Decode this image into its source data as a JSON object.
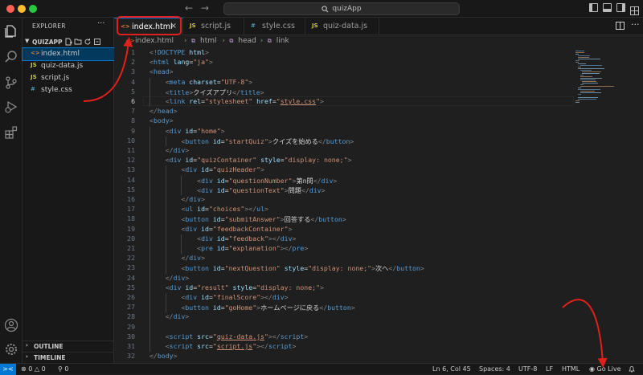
{
  "window": {
    "search_text": "quizApp"
  },
  "sidebar": {
    "title": "EXPLORER",
    "more": "···",
    "folder": "QUIZAPP",
    "files": [
      {
        "label": "index.html",
        "icon": "<>",
        "kind": "html",
        "active": true
      },
      {
        "label": "quiz-data.js",
        "icon": "JS",
        "kind": "js",
        "active": false
      },
      {
        "label": "script.js",
        "icon": "JS",
        "kind": "js",
        "active": false
      },
      {
        "label": "style.css",
        "icon": "#",
        "kind": "css",
        "active": false
      }
    ],
    "outline": "OUTLINE",
    "timeline": "TIMELINE"
  },
  "tabs": [
    {
      "label": "index.html",
      "icon": "<>",
      "kind": "html",
      "active": true,
      "close": "×"
    },
    {
      "label": "script.js",
      "icon": "JS",
      "kind": "js",
      "active": false
    },
    {
      "label": "style.css",
      "icon": "#",
      "kind": "css",
      "active": false
    },
    {
      "label": "quiz-data.js",
      "icon": "JS",
      "kind": "js",
      "active": false
    }
  ],
  "tab_more": "···",
  "breadcrumb": [
    "index.html",
    "html",
    "head",
    "link"
  ],
  "current_line": 6,
  "code": [
    [
      [
        "t-brk",
        "<!"
      ],
      [
        "t-tag",
        "DOCTYPE"
      ],
      [
        "t-attr",
        " html"
      ],
      [
        "t-brk",
        ">"
      ]
    ],
    [
      [
        "t-brk",
        "<"
      ],
      [
        "t-tag",
        "html"
      ],
      [
        "t-attr",
        " lang"
      ],
      [
        "t-txt",
        "="
      ],
      [
        "t-str",
        "\"ja\""
      ],
      [
        "t-brk",
        ">"
      ]
    ],
    [
      [
        "t-brk",
        "<"
      ],
      [
        "t-tag",
        "head"
      ],
      [
        "t-brk",
        ">"
      ]
    ],
    [
      [
        "t-txt",
        "    "
      ],
      [
        "t-brk",
        "<"
      ],
      [
        "t-tag",
        "meta"
      ],
      [
        "t-attr",
        " charset"
      ],
      [
        "t-txt",
        "="
      ],
      [
        "t-str",
        "\"UTF-8\""
      ],
      [
        "t-brk",
        ">"
      ]
    ],
    [
      [
        "t-txt",
        "    "
      ],
      [
        "t-brk",
        "<"
      ],
      [
        "t-tag",
        "title"
      ],
      [
        "t-brk",
        ">"
      ],
      [
        "t-txt",
        "クイズアプリ"
      ],
      [
        "t-brk",
        "</"
      ],
      [
        "t-tag",
        "title"
      ],
      [
        "t-brk",
        ">"
      ]
    ],
    [
      [
        "t-txt",
        "    "
      ],
      [
        "t-brk",
        "<"
      ],
      [
        "t-tag",
        "link"
      ],
      [
        "t-attr",
        " rel"
      ],
      [
        "t-txt",
        "="
      ],
      [
        "t-str",
        "\"stylesheet\""
      ],
      [
        "t-attr",
        " href"
      ],
      [
        "t-txt",
        "="
      ],
      [
        "t-str",
        "\""
      ],
      [
        "t-str t-ul",
        "style.css"
      ],
      [
        "t-str",
        "\""
      ],
      [
        "t-brk",
        ">"
      ]
    ],
    [
      [
        "t-brk",
        "</"
      ],
      [
        "t-tag",
        "head"
      ],
      [
        "t-brk",
        ">"
      ]
    ],
    [
      [
        "t-brk",
        "<"
      ],
      [
        "t-tag",
        "body"
      ],
      [
        "t-brk",
        ">"
      ]
    ],
    [
      [
        "t-txt",
        "    "
      ],
      [
        "t-brk",
        "<"
      ],
      [
        "t-tag",
        "div"
      ],
      [
        "t-attr",
        " id"
      ],
      [
        "t-txt",
        "="
      ],
      [
        "t-str",
        "\"home\""
      ],
      [
        "t-brk",
        ">"
      ]
    ],
    [
      [
        "t-txt",
        "        "
      ],
      [
        "t-brk",
        "<"
      ],
      [
        "t-tag",
        "button"
      ],
      [
        "t-attr",
        " id"
      ],
      [
        "t-txt",
        "="
      ],
      [
        "t-str",
        "\"startQuiz\""
      ],
      [
        "t-brk",
        ">"
      ],
      [
        "t-txt",
        "クイズを始める"
      ],
      [
        "t-brk",
        "</"
      ],
      [
        "t-tag",
        "button"
      ],
      [
        "t-brk",
        ">"
      ]
    ],
    [
      [
        "t-txt",
        "    "
      ],
      [
        "t-brk",
        "</"
      ],
      [
        "t-tag",
        "div"
      ],
      [
        "t-brk",
        ">"
      ]
    ],
    [
      [
        "t-txt",
        "    "
      ],
      [
        "t-brk",
        "<"
      ],
      [
        "t-tag",
        "div"
      ],
      [
        "t-attr",
        " id"
      ],
      [
        "t-txt",
        "="
      ],
      [
        "t-str",
        "\"quizContainer\""
      ],
      [
        "t-attr",
        " style"
      ],
      [
        "t-txt",
        "="
      ],
      [
        "t-str",
        "\"display: none;\""
      ],
      [
        "t-brk",
        ">"
      ]
    ],
    [
      [
        "t-txt",
        "        "
      ],
      [
        "t-brk",
        "<"
      ],
      [
        "t-tag",
        "div"
      ],
      [
        "t-attr",
        " id"
      ],
      [
        "t-txt",
        "="
      ],
      [
        "t-str",
        "\"quizHeader\""
      ],
      [
        "t-brk",
        ">"
      ]
    ],
    [
      [
        "t-txt",
        "            "
      ],
      [
        "t-brk",
        "<"
      ],
      [
        "t-tag",
        "div"
      ],
      [
        "t-attr",
        " id"
      ],
      [
        "t-txt",
        "="
      ],
      [
        "t-str",
        "\"questionNumber\""
      ],
      [
        "t-brk",
        ">"
      ],
      [
        "t-txt",
        "第n問"
      ],
      [
        "t-brk",
        "</"
      ],
      [
        "t-tag",
        "div"
      ],
      [
        "t-brk",
        ">"
      ]
    ],
    [
      [
        "t-txt",
        "            "
      ],
      [
        "t-brk",
        "<"
      ],
      [
        "t-tag",
        "div"
      ],
      [
        "t-attr",
        " id"
      ],
      [
        "t-txt",
        "="
      ],
      [
        "t-str",
        "\"questionText\""
      ],
      [
        "t-brk",
        ">"
      ],
      [
        "t-txt",
        "問題"
      ],
      [
        "t-brk",
        "</"
      ],
      [
        "t-tag",
        "div"
      ],
      [
        "t-brk",
        ">"
      ]
    ],
    [
      [
        "t-txt",
        "        "
      ],
      [
        "t-brk",
        "</"
      ],
      [
        "t-tag",
        "div"
      ],
      [
        "t-brk",
        ">"
      ]
    ],
    [
      [
        "t-txt",
        "        "
      ],
      [
        "t-brk",
        "<"
      ],
      [
        "t-tag",
        "ul"
      ],
      [
        "t-attr",
        " id"
      ],
      [
        "t-txt",
        "="
      ],
      [
        "t-str",
        "\"choices\""
      ],
      [
        "t-brk",
        "></"
      ],
      [
        "t-tag",
        "ul"
      ],
      [
        "t-brk",
        ">"
      ]
    ],
    [
      [
        "t-txt",
        "        "
      ],
      [
        "t-brk",
        "<"
      ],
      [
        "t-tag",
        "button"
      ],
      [
        "t-attr",
        " id"
      ],
      [
        "t-txt",
        "="
      ],
      [
        "t-str",
        "\"submitAnswer\""
      ],
      [
        "t-brk",
        ">"
      ],
      [
        "t-txt",
        "回答する"
      ],
      [
        "t-brk",
        "</"
      ],
      [
        "t-tag",
        "button"
      ],
      [
        "t-brk",
        ">"
      ]
    ],
    [
      [
        "t-txt",
        "        "
      ],
      [
        "t-brk",
        "<"
      ],
      [
        "t-tag",
        "div"
      ],
      [
        "t-attr",
        " id"
      ],
      [
        "t-txt",
        "="
      ],
      [
        "t-str",
        "\"feedbackContainer\""
      ],
      [
        "t-brk",
        ">"
      ]
    ],
    [
      [
        "t-txt",
        "            "
      ],
      [
        "t-brk",
        "<"
      ],
      [
        "t-tag",
        "div"
      ],
      [
        "t-attr",
        " id"
      ],
      [
        "t-txt",
        "="
      ],
      [
        "t-str",
        "\"feedback\""
      ],
      [
        "t-brk",
        "></"
      ],
      [
        "t-tag",
        "div"
      ],
      [
        "t-brk",
        ">"
      ]
    ],
    [
      [
        "t-txt",
        "            "
      ],
      [
        "t-brk",
        "<"
      ],
      [
        "t-tag",
        "pre"
      ],
      [
        "t-attr",
        " id"
      ],
      [
        "t-txt",
        "="
      ],
      [
        "t-str",
        "\"explanation\""
      ],
      [
        "t-brk",
        "></"
      ],
      [
        "t-tag",
        "pre"
      ],
      [
        "t-brk",
        ">"
      ]
    ],
    [
      [
        "t-txt",
        "        "
      ],
      [
        "t-brk",
        "</"
      ],
      [
        "t-tag",
        "div"
      ],
      [
        "t-brk",
        ">"
      ]
    ],
    [
      [
        "t-txt",
        "        "
      ],
      [
        "t-brk",
        "<"
      ],
      [
        "t-tag",
        "button"
      ],
      [
        "t-attr",
        " id"
      ],
      [
        "t-txt",
        "="
      ],
      [
        "t-str",
        "\"nextQuestion\""
      ],
      [
        "t-attr",
        " style"
      ],
      [
        "t-txt",
        "="
      ],
      [
        "t-str",
        "\"display: none;\""
      ],
      [
        "t-brk",
        ">"
      ],
      [
        "t-txt",
        "次へ"
      ],
      [
        "t-brk",
        "</"
      ],
      [
        "t-tag",
        "button"
      ],
      [
        "t-brk",
        ">"
      ]
    ],
    [
      [
        "t-txt",
        "    "
      ],
      [
        "t-brk",
        "</"
      ],
      [
        "t-tag",
        "div"
      ],
      [
        "t-brk",
        ">"
      ]
    ],
    [
      [
        "t-txt",
        "    "
      ],
      [
        "t-brk",
        "<"
      ],
      [
        "t-tag",
        "div"
      ],
      [
        "t-attr",
        " id"
      ],
      [
        "t-txt",
        "="
      ],
      [
        "t-str",
        "\"result\""
      ],
      [
        "t-attr",
        " style"
      ],
      [
        "t-txt",
        "="
      ],
      [
        "t-str",
        "\"display: none;\""
      ],
      [
        "t-brk",
        ">"
      ]
    ],
    [
      [
        "t-txt",
        "        "
      ],
      [
        "t-brk",
        "<"
      ],
      [
        "t-tag",
        "div"
      ],
      [
        "t-attr",
        " id"
      ],
      [
        "t-txt",
        "="
      ],
      [
        "t-str",
        "\"finalScore\""
      ],
      [
        "t-brk",
        "></"
      ],
      [
        "t-tag",
        "div"
      ],
      [
        "t-brk",
        ">"
      ]
    ],
    [
      [
        "t-txt",
        "        "
      ],
      [
        "t-brk",
        "<"
      ],
      [
        "t-tag",
        "button"
      ],
      [
        "t-attr",
        " id"
      ],
      [
        "t-txt",
        "="
      ],
      [
        "t-str",
        "\"goHome\""
      ],
      [
        "t-brk",
        ">"
      ],
      [
        "t-txt",
        "ホームページに戻る"
      ],
      [
        "t-brk",
        "</"
      ],
      [
        "t-tag",
        "button"
      ],
      [
        "t-brk",
        ">"
      ]
    ],
    [
      [
        "t-txt",
        "    "
      ],
      [
        "t-brk",
        "</"
      ],
      [
        "t-tag",
        "div"
      ],
      [
        "t-brk",
        ">"
      ]
    ],
    [],
    [
      [
        "t-txt",
        "    "
      ],
      [
        "t-brk",
        "<"
      ],
      [
        "t-tag",
        "script"
      ],
      [
        "t-attr",
        " src"
      ],
      [
        "t-txt",
        "="
      ],
      [
        "t-str",
        "\""
      ],
      [
        "t-str t-ul",
        "quiz-data.js"
      ],
      [
        "t-str",
        "\""
      ],
      [
        "t-brk",
        "></"
      ],
      [
        "t-tag",
        "script"
      ],
      [
        "t-brk",
        ">"
      ]
    ],
    [
      [
        "t-txt",
        "    "
      ],
      [
        "t-brk",
        "<"
      ],
      [
        "t-tag",
        "script"
      ],
      [
        "t-attr",
        " src"
      ],
      [
        "t-txt",
        "="
      ],
      [
        "t-str",
        "\""
      ],
      [
        "t-str t-ul",
        "script.js"
      ],
      [
        "t-str",
        "\""
      ],
      [
        "t-brk",
        "></"
      ],
      [
        "t-tag",
        "script"
      ],
      [
        "t-brk",
        ">"
      ]
    ],
    [
      [
        "t-brk",
        "</"
      ],
      [
        "t-tag",
        "body"
      ],
      [
        "t-brk",
        ">"
      ]
    ],
    [
      [
        "t-brk",
        "</"
      ],
      [
        "t-tag",
        "html"
      ],
      [
        "t-brk",
        ">"
      ]
    ]
  ],
  "status": {
    "remote_icon": "><",
    "errors": "0",
    "warnings": "0",
    "ports": "0",
    "position": "Ln 6, Col 45",
    "spaces": "Spaces: 4",
    "encoding": "UTF-8",
    "eol": "LF",
    "language": "HTML",
    "golive": "Go Live",
    "bell_icon": "bell-icon"
  },
  "colors": {
    "accent": "#0078d4",
    "annotation": "#e0201b"
  }
}
